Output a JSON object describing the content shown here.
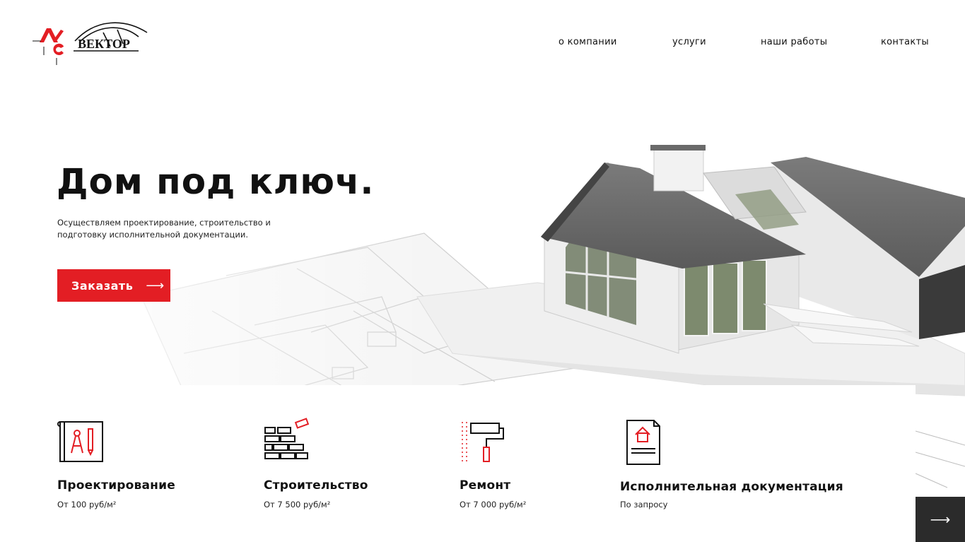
{
  "logo": {
    "text": "ВЕКТОР",
    "letters": "АС",
    "icon": "logo-mark"
  },
  "nav": {
    "items": [
      {
        "label": "о компании"
      },
      {
        "label": "услуги"
      },
      {
        "label": "наши работы"
      },
      {
        "label": "контакты"
      }
    ]
  },
  "hero": {
    "title": "Дом под ключ.",
    "subtitle": "Осуществляем проектирование, строительство и подготовку исполнительной документации.",
    "cta_label": "Заказать",
    "cta_arrow": "⟶"
  },
  "services": [
    {
      "title": "Проектирование",
      "price": "От 100 руб/м²",
      "icon": "blueprint-compass-icon"
    },
    {
      "title": "Строительство",
      "price": "От 7 500 руб/м²",
      "icon": "brick-wall-icon"
    },
    {
      "title": "Ремонт",
      "price": "От 7 000 руб/м²",
      "icon": "paint-roller-icon"
    },
    {
      "title": "Исполнительная документация",
      "price": "По запросу",
      "icon": "house-document-icon"
    }
  ],
  "next_button": {
    "arrow": "⟶"
  },
  "colors": {
    "accent": "#e31e24",
    "text": "#111111",
    "dark_button": "#2b2b2b"
  }
}
